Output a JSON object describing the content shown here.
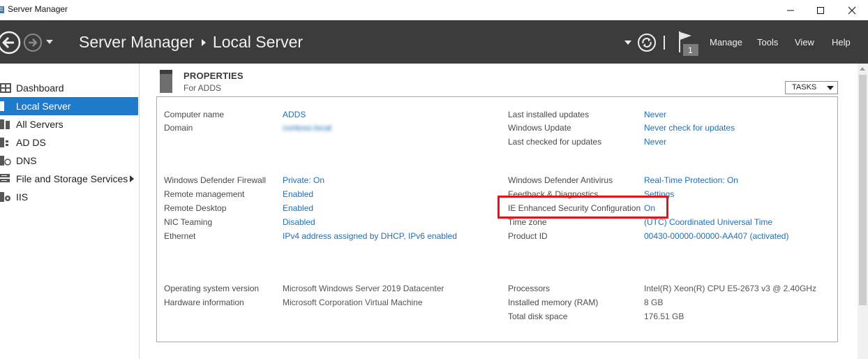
{
  "window": {
    "title": "Server Manager",
    "app_icon": "server-manager-icon",
    "controls": {
      "minimize": "minimize-icon",
      "maximize": "maximize-icon",
      "close": "close-icon"
    }
  },
  "header": {
    "breadcrumb_root": "Server Manager",
    "breadcrumb_current": "Local Server",
    "notification_count": "1",
    "menus": [
      "Manage",
      "Tools",
      "View",
      "Help"
    ]
  },
  "sidebar": {
    "items": [
      {
        "label": "Dashboard",
        "icon": "dashboard-icon"
      },
      {
        "label": "Local Server",
        "icon": "local-server-icon",
        "active": true
      },
      {
        "label": "All Servers",
        "icon": "all-servers-icon"
      },
      {
        "label": "AD DS",
        "icon": "ad-ds-icon"
      },
      {
        "label": "DNS",
        "icon": "dns-icon"
      },
      {
        "label": "File and Storage Services",
        "icon": "storage-icon",
        "has_children": true
      },
      {
        "label": "IIS",
        "icon": "iis-icon"
      }
    ]
  },
  "properties": {
    "title": "PROPERTIES",
    "subtitle": "For ADDS",
    "tasks_label": "TASKS",
    "left": {
      "computer_name": {
        "label": "Computer name",
        "value": "ADDS"
      },
      "domain": {
        "label": "Domain",
        "value": "contoso.local"
      },
      "firewall": {
        "label": "Windows Defender Firewall",
        "value": "Private: On"
      },
      "remote_mgmt": {
        "label": "Remote management",
        "value": "Enabled"
      },
      "remote_desktop": {
        "label": "Remote Desktop",
        "value": "Enabled"
      },
      "nic_teaming": {
        "label": "NIC Teaming",
        "value": "Disabled"
      },
      "ethernet": {
        "label": "Ethernet",
        "value": "IPv4 address assigned by DHCP, IPv6 enabled"
      },
      "os_version": {
        "label": "Operating system version",
        "value": "Microsoft Windows Server 2019 Datacenter"
      },
      "hardware": {
        "label": "Hardware information",
        "value": "Microsoft Corporation Virtual Machine"
      }
    },
    "right": {
      "last_updates": {
        "label": "Last installed updates",
        "value": "Never"
      },
      "windows_update": {
        "label": "Windows Update",
        "value": "Never check for updates"
      },
      "last_checked": {
        "label": "Last checked for updates",
        "value": "Never"
      },
      "antivirus": {
        "label": "Windows Defender Antivirus",
        "value": "Real-Time Protection: On"
      },
      "feedback": {
        "label": "Feedback & Diagnostics",
        "value": "Settings"
      },
      "ie_esc": {
        "label": "IE Enhanced Security Configuration",
        "value": "On"
      },
      "time_zone": {
        "label": "Time zone",
        "value": "(UTC) Coordinated Universal Time"
      },
      "product_id": {
        "label": "Product ID",
        "value": "00430-00000-00000-AA407 (activated)"
      },
      "processors": {
        "label": "Processors",
        "value": "Intel(R) Xeon(R) CPU E5-2673 v3 @ 2.40GHz"
      },
      "memory": {
        "label": "Installed memory (RAM)",
        "value": "8 GB"
      },
      "disk": {
        "label": "Total disk space",
        "value": "176.51 GB"
      }
    }
  },
  "colors": {
    "header_bg": "#3c3c3c",
    "active_nav": "#1f7acb",
    "link": "#1e6fb8",
    "highlight": "#e0141b"
  }
}
